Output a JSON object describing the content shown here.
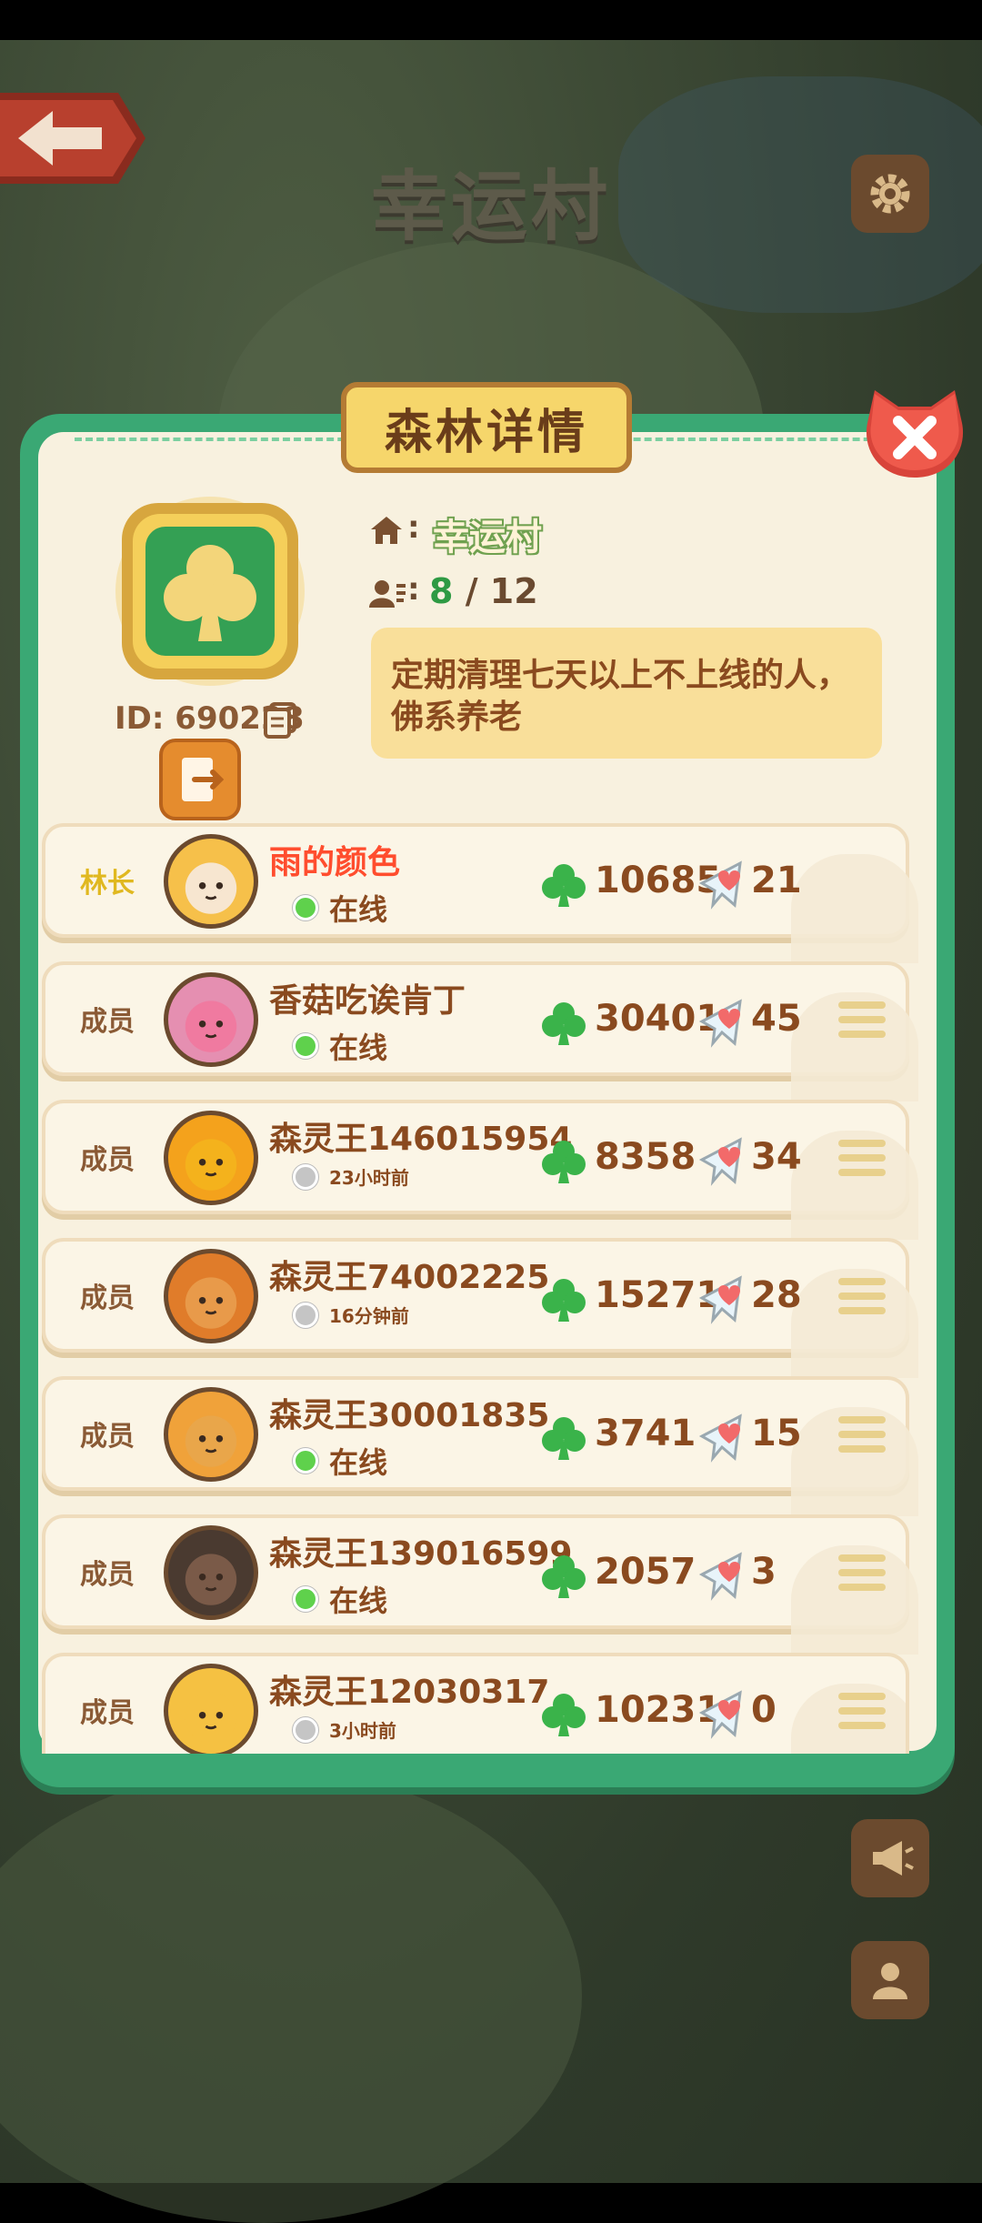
{
  "header": {
    "village_title": "幸运村"
  },
  "dialog": {
    "title": "森林详情",
    "forest": {
      "id_label": "ID: 690228",
      "village_name": "幸运村",
      "member_current": "8",
      "member_sep": "/ 12",
      "notice": "定期清理七天以上不上线的人，佛系养老"
    },
    "members": [
      {
        "role": "林长",
        "name": "雨的颜色",
        "status": "在线",
        "online": true,
        "score": "10685",
        "likes": "21",
        "leader": true
      },
      {
        "role": "成员",
        "name": "香菇吃诶肯丁",
        "status": "在线",
        "online": true,
        "score": "30401",
        "likes": "45",
        "leader": false
      },
      {
        "role": "成员",
        "name": "森灵王146015954",
        "status": "23小时前",
        "online": false,
        "score": "8358",
        "likes": "34",
        "leader": false
      },
      {
        "role": "成员",
        "name": "森灵王74002225",
        "status": "16分钟前",
        "online": false,
        "score": "15271",
        "likes": "28",
        "leader": false
      },
      {
        "role": "成员",
        "name": "森灵王30001835",
        "status": "在线",
        "online": true,
        "score": "3741",
        "likes": "15",
        "leader": false
      },
      {
        "role": "成员",
        "name": "森灵王139016599",
        "status": "在线",
        "online": true,
        "score": "2057",
        "likes": "3",
        "leader": false
      },
      {
        "role": "成员",
        "name": "森灵王12030317",
        "status": "3小时前",
        "online": false,
        "score": "10231",
        "likes": "0",
        "leader": false
      }
    ]
  },
  "colors": {
    "dialog_border": "#3aa874",
    "panel_bg": "#f8f1df",
    "title_plate": "#f6d66b",
    "leader_name": "#ff4d2e",
    "online_dot": "#5fd14c",
    "clover": "#3ab34a"
  },
  "icons": [
    "back-arrow-icon",
    "gear-icon",
    "close-icon",
    "clover-emblem-icon",
    "copy-icon",
    "exit-icon",
    "home-icon",
    "members-icon",
    "clover-icon",
    "heart-icon",
    "menu-icon",
    "megaphone-icon",
    "profile-card-icon"
  ]
}
